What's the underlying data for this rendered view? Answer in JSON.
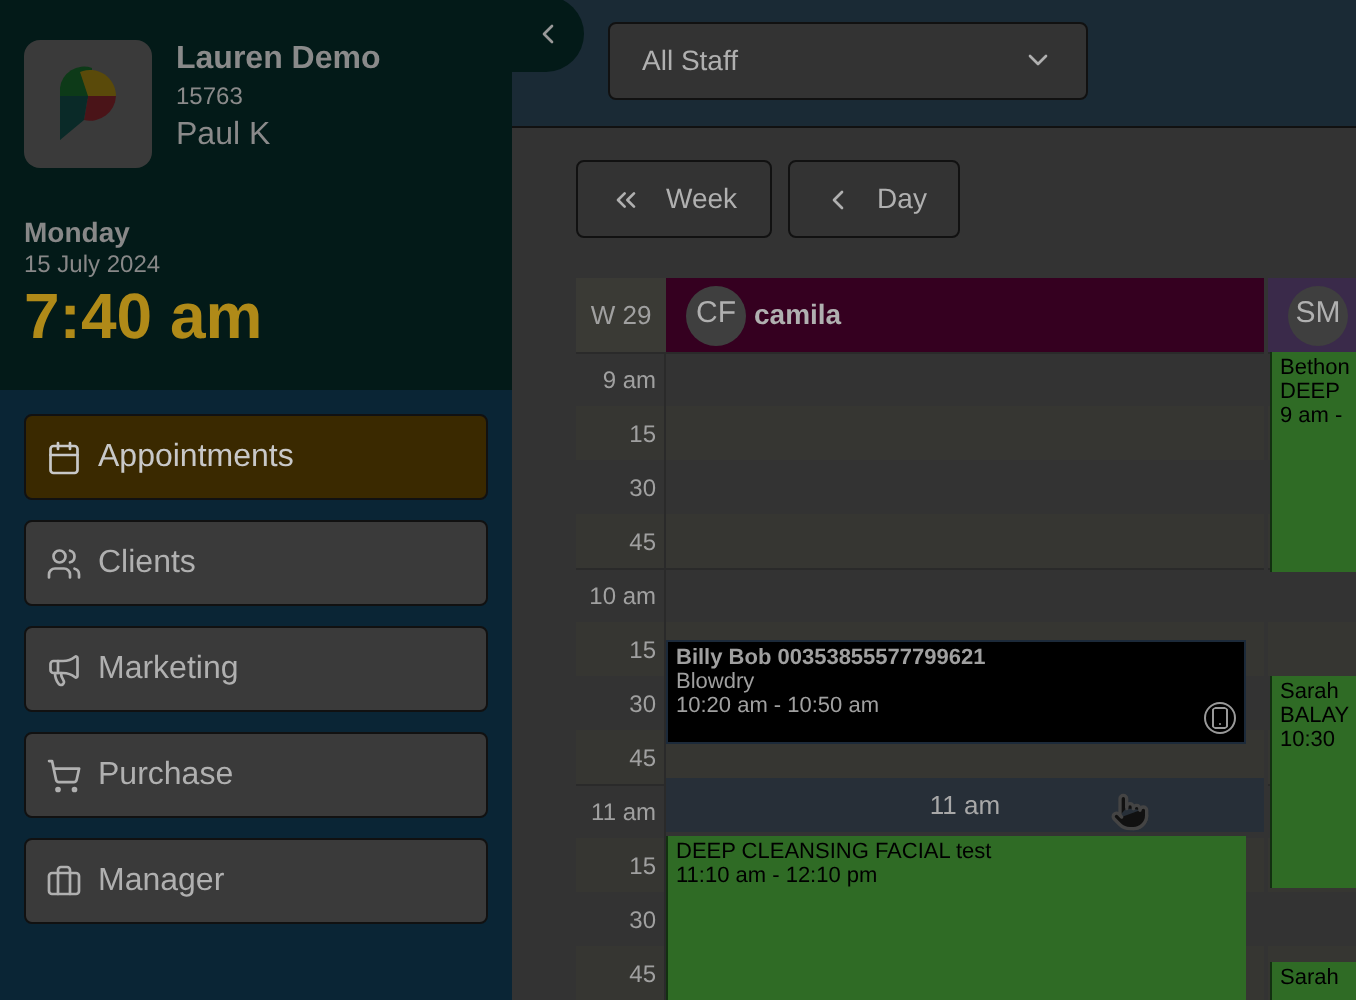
{
  "profile": {
    "business": "Lauren Demo",
    "code": "15763",
    "user": "Paul K"
  },
  "today": {
    "day": "Monday",
    "date": "15 July 2024",
    "time": "7:40 am"
  },
  "nav": [
    {
      "label": "Appointments",
      "selected": true
    },
    {
      "label": "Clients",
      "selected": false
    },
    {
      "label": "Marketing",
      "selected": false
    },
    {
      "label": "Purchase",
      "selected": false
    },
    {
      "label": "Manager",
      "selected": false
    }
  ],
  "staff_filter": {
    "value": "All Staff"
  },
  "view_buttons": [
    {
      "label": "Week",
      "kind": "double"
    },
    {
      "label": "Day",
      "kind": "single"
    }
  ],
  "calendar": {
    "week": "W 29",
    "times": [
      "9 am",
      "15",
      "30",
      "45",
      "10 am",
      "15",
      "30",
      "45",
      "11 am",
      "15",
      "30",
      "45"
    ],
    "hover_slot": "11 am",
    "columns": [
      {
        "initials": "CF",
        "name": "camila",
        "color": "#350020",
        "events": [
          {
            "kind": "dark",
            "lines": [
              "Billy Bob  00353855577799621",
              "Blowdry",
              "10:20 am - 10:50 am"
            ],
            "phone": true
          },
          {
            "kind": "green",
            "lines": [
              "DEEP CLEANSING FACIAL test",
              "11:10 am - 12:10 pm"
            ]
          }
        ]
      },
      {
        "initials": "SM",
        "color": "#3a2a4a",
        "events": [
          {
            "kind": "green",
            "lines": [
              "Bethon",
              "DEEP",
              "9 am -"
            ],
            "phone": false
          },
          {
            "kind": "green",
            "lines": [
              "Sarah",
              "BALAY",
              "10:30"
            ],
            "phone": false
          },
          {
            "kind": "green",
            "lines": [
              "Sarah"
            ]
          }
        ]
      }
    ]
  }
}
